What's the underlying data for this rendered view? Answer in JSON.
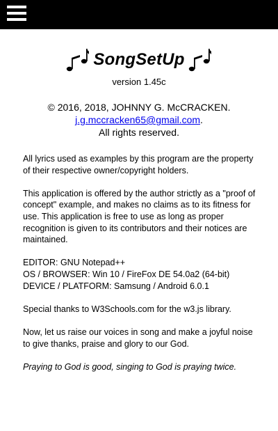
{
  "app": {
    "title": "SongSetUp",
    "version": "version 1.45c"
  },
  "topbar": {
    "menu_icon": "hamburger-menu-icon",
    "background": "#000000"
  },
  "copyright": {
    "line1": "© 2016, 2018, JOHNNY G. McCRACKEN.",
    "email": "j.g.mccracken65@gmail.com",
    "email_suffix": ".",
    "line3": "All rights reserved."
  },
  "body": {
    "para_lyrics": "All lyrics used as examples by this program are the property of their respective owner/copyright holders.",
    "para_concept": "This application is offered by the author strictly as a \"proof of concept\" example, and makes no claims as to its fitness for use. This application is free to use as long as proper recognition is given to its contributors and their notices are maintained.",
    "editor": "EDITOR: GNU Notepad++",
    "os_browser": "OS / BROWSER: Win 10 / FireFox DE 54.0a2 (64-bit)",
    "device": "DEVICE / PLATFORM: Samsung / Android 6.0.1",
    "thanks": "Special thanks to W3Schools.com for the w3.js library.",
    "closing": "Now, let us raise our voices in song and make a joyful noise to give thanks, praise and glory to our God.",
    "quote": "Praying to God is good, singing to God is praying twice."
  },
  "colors": {
    "link": "#0000ee",
    "text": "#000000",
    "background": "#ffffff"
  }
}
